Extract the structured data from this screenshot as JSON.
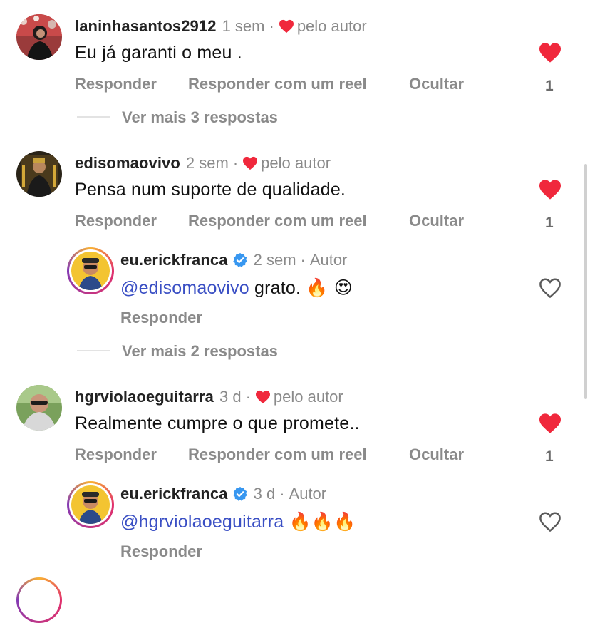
{
  "comments": [
    {
      "username": "laninhasantos2912",
      "time": "1 sem",
      "author_like": "pelo autor",
      "text": "Eu já garanti o meu .",
      "actions": {
        "reply": "Responder",
        "reel": "Responder com um reel",
        "hide": "Ocultar"
      },
      "like_count": "1",
      "view_more": "Ver mais 3 respostas"
    },
    {
      "username": "edisomaovivo",
      "time": "2 sem",
      "author_like": "pelo autor",
      "text": "Pensa num suporte de qualidade.",
      "actions": {
        "reply": "Responder",
        "reel": "Responder com um reel",
        "hide": "Ocultar"
      },
      "like_count": "1",
      "reply": {
        "username": "eu.erickfranca",
        "time": "2 sem",
        "badge": "Autor",
        "mention": "@edisomaovivo",
        "text": " grato. ",
        "emojis": "🔥 😍",
        "action": "Responder"
      },
      "view_more": "Ver mais 2 respostas"
    },
    {
      "username": "hgrviolaoeguitarra",
      "time": "3 d",
      "author_like": "pelo autor",
      "text": "Realmente cumpre o que promete..",
      "actions": {
        "reply": "Responder",
        "reel": "Responder com um reel",
        "hide": "Ocultar"
      },
      "like_count": "1",
      "reply": {
        "username": "eu.erickfranca",
        "time": "3 d",
        "badge": "Autor",
        "mention": "@hgrviolaoeguitarra",
        "text": " ",
        "emojis": "🔥🔥🔥",
        "action": "Responder"
      }
    }
  ],
  "colors": {
    "heart": "#f0283c",
    "mention": "#3a4fc4",
    "muted": "#8a8a8a",
    "verified": "#3897f0",
    "story_ring": "#d62976"
  },
  "icons": [
    "heart-icon",
    "heart-outline-icon",
    "verified-badge-icon"
  ]
}
